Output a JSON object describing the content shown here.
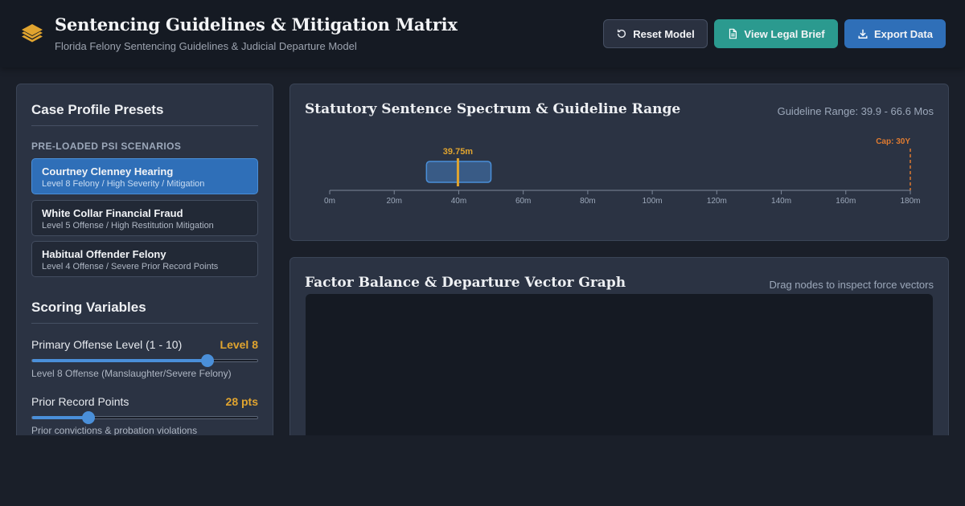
{
  "header": {
    "title": "Sentencing Guidelines & Mitigation Matrix",
    "subtitle": "Florida Felony Sentencing Guidelines & Judicial Departure Model",
    "buttons": {
      "reset": "Reset Model",
      "brief": "View Legal Brief",
      "export": "Export Data"
    }
  },
  "presets": {
    "title": "Case Profile Presets",
    "subhead": "PRE-LOADED PSI SCENARIOS",
    "items": [
      {
        "title": "Courtney Clenney Hearing",
        "desc": "Level 8 Felony / High Severity / Mitigation",
        "active": true
      },
      {
        "title": "White Collar Financial Fraud",
        "desc": "Level 5 Offense / High Restitution Mitigation",
        "active": false
      },
      {
        "title": "Habitual Offender Felony",
        "desc": "Level 4 Offense / Severe Prior Record Points",
        "active": false
      }
    ]
  },
  "scoring": {
    "title": "Scoring Variables",
    "offense": {
      "label": "Primary Offense Level (1 - 10)",
      "value_text": "Level 8",
      "note": "Level 8 Offense (Manslaughter/Severe Felony)",
      "min": 1,
      "max": 10,
      "value": 8
    },
    "prior": {
      "label": "Prior Record Points",
      "value_text": "28 pts",
      "note": "Prior convictions & probation violations",
      "min": 0,
      "max": 100,
      "value": 25
    }
  },
  "spectrum": {
    "title": "Statutory Sentence Spectrum & Guideline Range",
    "range_text": "Guideline Range: 39.9 - 66.6 Mos",
    "marker_label": "39.75m",
    "cap_label": "Cap: 30Y",
    "chart_data": {
      "type": "range",
      "x_min": 0,
      "x_max": 180,
      "ticks": [
        "0m",
        "20m",
        "40m",
        "60m",
        "80m",
        "100m",
        "120m",
        "140m",
        "160m",
        "180m"
      ],
      "tick_values": [
        0,
        20,
        40,
        60,
        80,
        100,
        120,
        140,
        160,
        180
      ],
      "box_start": 30,
      "box_end": 50,
      "marker": 39.75,
      "cap": 180
    },
    "colors": {
      "box": "#3f6a9c",
      "marker": "#e0a42f",
      "cap": "#e07b30"
    }
  },
  "graph": {
    "title": "Factor Balance & Departure Vector Graph",
    "hint": "Drag nodes to inspect force vectors"
  }
}
